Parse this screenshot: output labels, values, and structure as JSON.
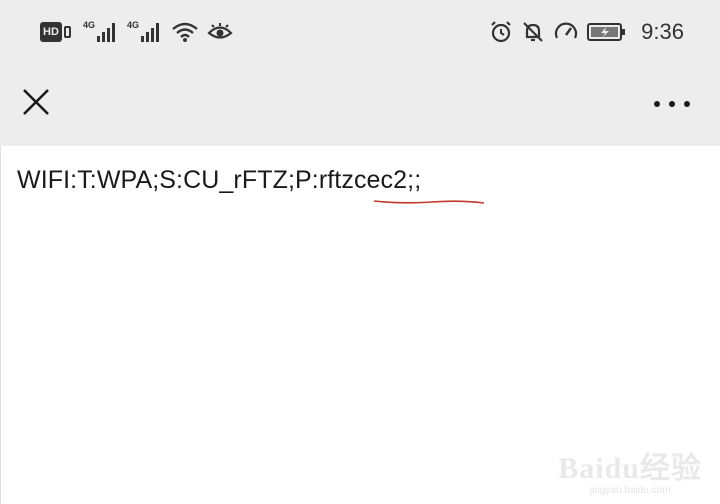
{
  "status_bar": {
    "hd_label": "HD",
    "network_type_1": "4G",
    "network_type_2": "4G",
    "time": "9:36",
    "icons": [
      "hd-icon",
      "signal-icon",
      "signal-icon",
      "wifi-icon",
      "eye-icon",
      "alarm-icon",
      "mute-icon",
      "speedometer-icon",
      "battery-icon"
    ]
  },
  "header": {
    "close_icon": "close-icon",
    "more_icon": "more-icon"
  },
  "content": {
    "qr_text": "WIFI:T:WPA;S:CU_rFTZ;P:rftzcec2;;"
  },
  "watermark": {
    "brand": "Baidu经验",
    "url": "jingyan.baidu.com"
  },
  "colors": {
    "status_bg": "#ededed",
    "content_bg": "#ffffff",
    "underline": "#c0392b",
    "text": "#1a1a1a"
  }
}
